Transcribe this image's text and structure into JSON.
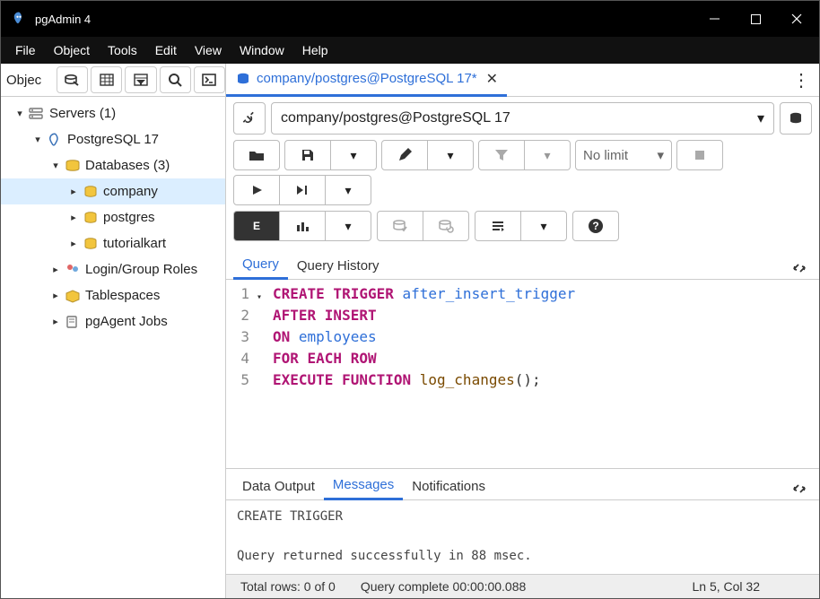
{
  "window": {
    "title": "pgAdmin 4"
  },
  "menu": {
    "file": "File",
    "object": "Object",
    "tools": "Tools",
    "edit": "Edit",
    "view": "View",
    "window": "Window",
    "help": "Help"
  },
  "sidebar": {
    "header_label": "Objec",
    "tree": {
      "servers": "Servers (1)",
      "pg17": "PostgreSQL 17",
      "databases": "Databases (3)",
      "db_company": "company",
      "db_postgres": "postgres",
      "db_tutorialkart": "tutorialkart",
      "login_roles": "Login/Group Roles",
      "tablespaces": "Tablespaces",
      "pgagent": "pgAgent Jobs"
    }
  },
  "tab": {
    "label": "company/postgres@PostgreSQL 17*"
  },
  "conn": {
    "label": "company/postgres@PostgreSQL 17"
  },
  "toolbar": {
    "limit": "No limit"
  },
  "query_tabs": {
    "query": "Query",
    "history": "Query History"
  },
  "sql": {
    "l1_a": "CREATE TRIGGER ",
    "l1_b": "after_insert_trigger",
    "l2": "AFTER INSERT",
    "l3_a": "ON ",
    "l3_b": "employees",
    "l4": "FOR EACH ROW",
    "l5_a": "EXECUTE FUNCTION ",
    "l5_b": "log_changes",
    "l5_c": "();"
  },
  "gutter": {
    "n1": "1",
    "n2": "2",
    "n3": "3",
    "n4": "4",
    "n5": "5"
  },
  "out_tabs": {
    "data": "Data Output",
    "messages": "Messages",
    "notif": "Notifications"
  },
  "messages": {
    "line1": "CREATE TRIGGER",
    "line2": "Query returned successfully in 88 msec."
  },
  "status": {
    "rows": "Total rows: 0 of 0",
    "time": "Query complete 00:00:00.088",
    "pos": "Ln 5, Col 32"
  }
}
